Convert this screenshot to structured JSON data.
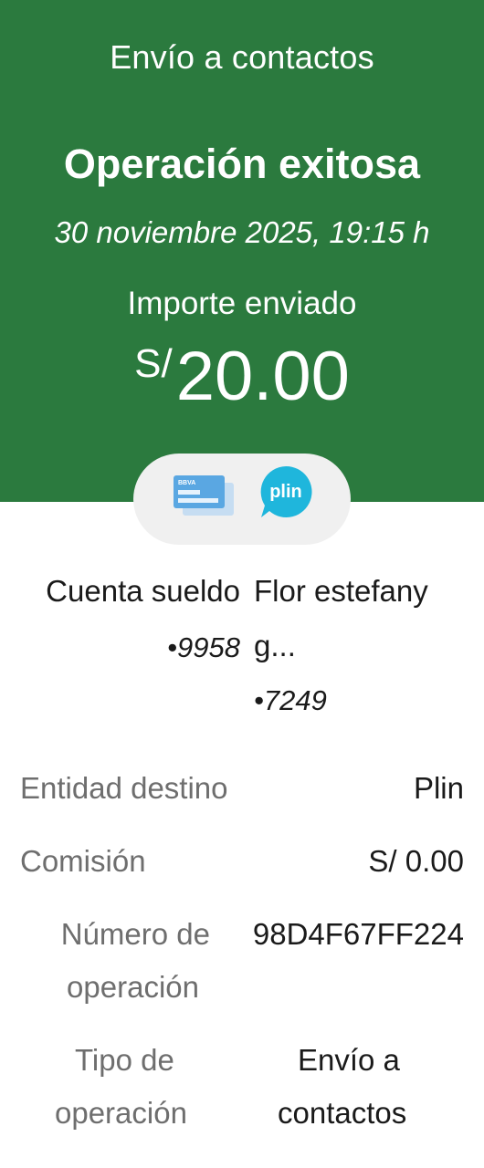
{
  "header": {
    "screen_title": "Envío a contactos",
    "status_title": "Operación exitosa",
    "datetime": "30 noviembre 2025, 19:15 h",
    "amount_label": "Importe enviado",
    "currency": "S/",
    "amount": "20.00",
    "background_color": "#2b7a3e"
  },
  "icons": {
    "card": "bbva-card-icon",
    "card_brand": "BBVA",
    "plin": "plin-logo-icon",
    "plin_text": "plin"
  },
  "origin": {
    "name": "Cuenta sueldo",
    "number": "•9958"
  },
  "destination": {
    "name_line1": "Flor estefany",
    "name_line2": "g...",
    "number": "•7249"
  },
  "details": {
    "entity_label": "Entidad destino",
    "entity_value": "Plin",
    "fee_label": "Comisión",
    "fee_value": "S/ 0.00",
    "op_number_label_1": "Número de",
    "op_number_label_2": "operación",
    "op_number_value": "98D4F67FF224",
    "op_type_label_1": "Tipo de",
    "op_type_label_2": "operación",
    "op_type_value_1": "Envío a",
    "op_type_value_2": "contactos"
  }
}
